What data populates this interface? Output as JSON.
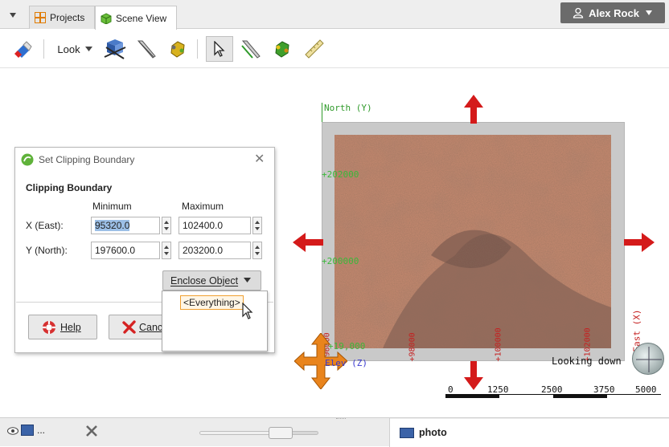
{
  "tabs": [
    {
      "label": "Projects",
      "icon": "projects-icon"
    },
    {
      "label": "Scene View",
      "icon": "cube-icon"
    }
  ],
  "user": {
    "name": "Alex Rock"
  },
  "toolbar": {
    "look_label": "Look"
  },
  "dialog": {
    "title": "Set Clipping Boundary",
    "section": "Clipping Boundary",
    "col_min": "Minimum",
    "col_max": "Maximum",
    "x_label": "X (East):",
    "y_label": "Y (North):",
    "x_min": "95320.0",
    "x_max": "102400.0",
    "y_min": "197600.0",
    "y_max": "203200.0",
    "enclose_label": "Enclose Object",
    "help_label": "Help",
    "cancel_label": "Canc",
    "dropdown_option": "<Everything>"
  },
  "scene": {
    "north_label": "North (Y)",
    "east_label": "East (X)",
    "elev_label": "Elev (Z)",
    "looking_label": "Looking down",
    "y_ticks": [
      "+202000",
      "+200000",
      "+19,000"
    ],
    "x_ticks": [
      "+96000",
      "+98000",
      "+100000",
      "+102000"
    ]
  },
  "scalebar": {
    "ticks": [
      "0",
      "1250",
      "2500",
      "3750",
      "5000"
    ]
  },
  "bottom": {
    "photo_label": "photo",
    "more_label": "..."
  }
}
